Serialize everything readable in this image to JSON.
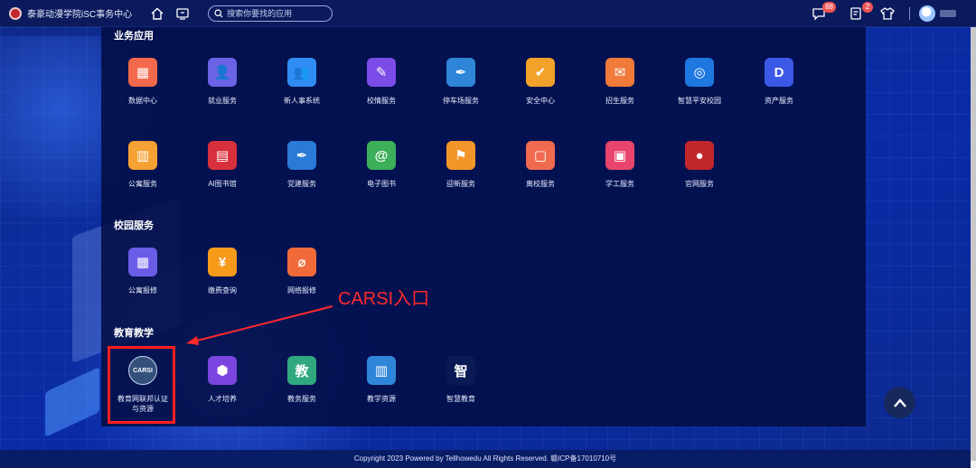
{
  "header": {
    "app_title": "泰豪动漫学院iSC事务中心",
    "search_placeholder": "搜索你要找的应用",
    "message_badge": "88",
    "notice_badge": "2"
  },
  "sections": {
    "business": {
      "title": "业务应用",
      "items": [
        "数据中心",
        "就业服务",
        "新人事系统",
        "校情服务",
        "停车场服务",
        "安全中心",
        "招生服务",
        "智慧平安校园",
        "资产服务",
        "公寓服务",
        "AI图书馆",
        "党建服务",
        "电子图书",
        "迎新服务",
        "离校服务",
        "学工服务",
        "官网服务"
      ]
    },
    "campus": {
      "title": "校园服务",
      "items": [
        "公寓报修",
        "缴费查询",
        "网络报修"
      ]
    },
    "teaching": {
      "title": "教育教学",
      "items": [
        "教育网联邦认证与资源",
        "人才培养",
        "教务服务",
        "教学资源",
        "智慧教育"
      ]
    }
  },
  "annotation": {
    "label": "CARSI入口"
  },
  "footer": {
    "text": "Copyright 2023 Powered by Tellhowedu All Rights Reserved. 赣ICP备17010710号"
  },
  "colors": {
    "accent_red": "#ff2a2a",
    "panel_bg": "#030e46"
  }
}
